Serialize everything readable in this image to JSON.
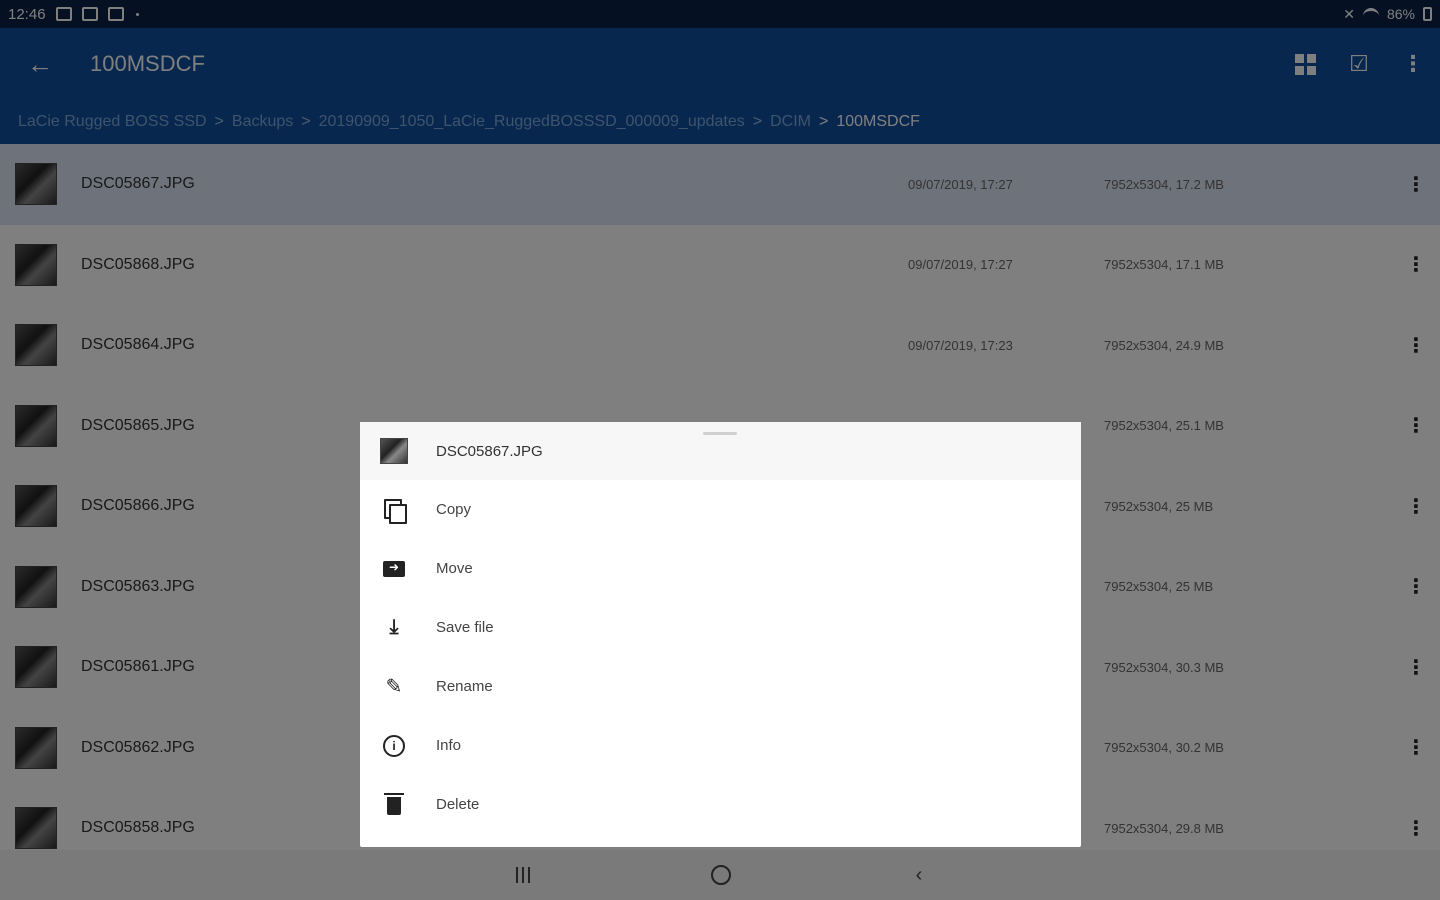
{
  "status_bar": {
    "time": "12:46",
    "battery": "86%"
  },
  "app_bar": {
    "title": "100MSDCF"
  },
  "breadcrumb": {
    "items": [
      "LaCie Rugged BOSS SSD",
      "Backups",
      "20190909_1050_LaCie_RuggedBOSSSD_000009_updates",
      "DCIM"
    ],
    "separator": ">",
    "current": "100MSDCF"
  },
  "files": [
    {
      "name": "DSC05867.JPG",
      "date": "09/07/2019, 17:27",
      "meta": "7952x5304, 17.2 MB"
    },
    {
      "name": "DSC05868.JPG",
      "date": "09/07/2019, 17:27",
      "meta": "7952x5304, 17.1 MB"
    },
    {
      "name": "DSC05864.JPG",
      "date": "09/07/2019, 17:23",
      "meta": "7952x5304, 24.9 MB"
    },
    {
      "name": "DSC05865.JPG",
      "date": "",
      "meta": "7952x5304, 25.1 MB"
    },
    {
      "name": "DSC05866.JPG",
      "date": "",
      "meta": "7952x5304, 25 MB"
    },
    {
      "name": "DSC05863.JPG",
      "date": "",
      "meta": "7952x5304, 25 MB"
    },
    {
      "name": "DSC05861.JPG",
      "date": "",
      "meta": "7952x5304, 30.3 MB"
    },
    {
      "name": "DSC05862.JPG",
      "date": "",
      "meta": "7952x5304, 30.2 MB"
    },
    {
      "name": "DSC05858.JPG",
      "date": "",
      "meta": "7952x5304, 29.8 MB"
    }
  ],
  "sheet": {
    "file_name": "DSC05867.JPG",
    "actions": [
      {
        "label": "Copy",
        "icon": "copy-icon"
      },
      {
        "label": "Move",
        "icon": "move-icon"
      },
      {
        "label": "Save file",
        "icon": "download-icon"
      },
      {
        "label": "Rename",
        "icon": "pencil-icon"
      },
      {
        "label": "Info",
        "icon": "info-icon"
      },
      {
        "label": "Delete",
        "icon": "trash-icon"
      }
    ]
  },
  "colors": {
    "app_bar": "#0e4f9e",
    "status_bar": "#0a2346",
    "selected_row": "#dde5f5"
  }
}
